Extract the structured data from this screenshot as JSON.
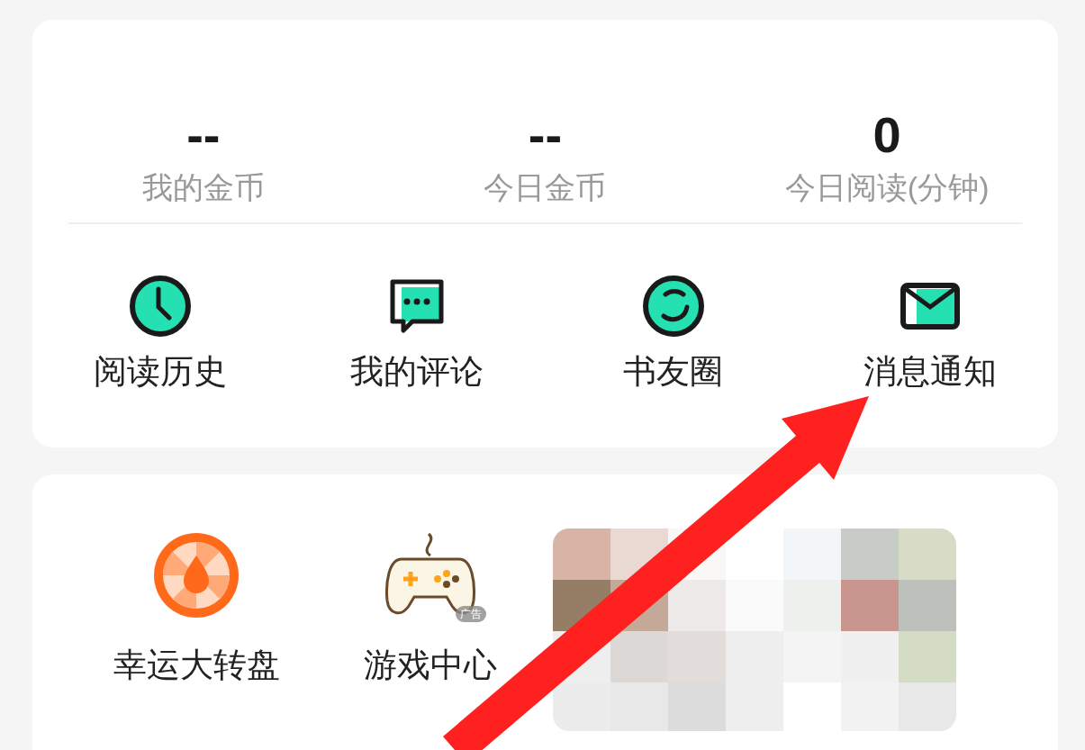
{
  "stats": [
    {
      "value": "--",
      "label": "我的金币"
    },
    {
      "value": "--",
      "label": "今日金币"
    },
    {
      "value": "0",
      "label": "今日阅读(分钟)"
    }
  ],
  "shortcuts": [
    {
      "kind": "clock",
      "label": "阅读历史"
    },
    {
      "kind": "comment",
      "label": "我的评论"
    },
    {
      "kind": "circle",
      "label": "书友圈"
    },
    {
      "kind": "mail",
      "label": "消息通知"
    }
  ],
  "promos": [
    {
      "kind": "wheel",
      "label": "幸运大转盘"
    },
    {
      "kind": "gamepad",
      "label": "游戏中心",
      "badge": "广告"
    }
  ]
}
